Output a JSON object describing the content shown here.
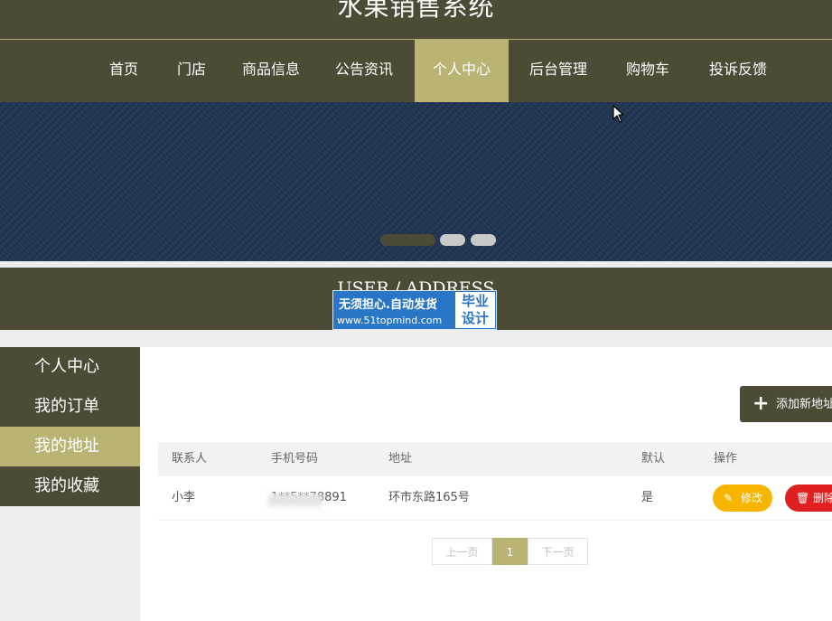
{
  "header": {
    "title": "水果销售系统"
  },
  "nav": {
    "items": [
      {
        "label": "首页",
        "active": false
      },
      {
        "label": "门店",
        "active": false
      },
      {
        "label": "商品信息",
        "active": false
      },
      {
        "label": "公告资讯",
        "active": false
      },
      {
        "label": "个人中心",
        "active": true
      },
      {
        "label": "后台管理",
        "active": false
      },
      {
        "label": "购物车",
        "active": false
      },
      {
        "label": "投诉反馈",
        "active": false
      }
    ]
  },
  "banner": {
    "slide_count": 3,
    "active_slide": 1
  },
  "section": {
    "title": "USER / ADDRESS"
  },
  "watermark": {
    "line1": "无须担心.自动发货",
    "url": "www.51topmind.com",
    "box_line1": "毕业",
    "box_line2": "设计"
  },
  "sidebar": {
    "items": [
      {
        "label": "个人中心",
        "active": false
      },
      {
        "label": "我的订单",
        "active": false
      },
      {
        "label": "我的地址",
        "active": true
      },
      {
        "label": "我的收藏",
        "active": false
      }
    ]
  },
  "toolbar": {
    "add_label": "添加新地址",
    "add_icon": "plus-icon"
  },
  "table": {
    "headers": [
      "联系人",
      "手机号码",
      "地址",
      "默认",
      "操作"
    ],
    "rows": [
      {
        "contact": "小李",
        "phone": "1**5**78891",
        "address": "环市东路165号",
        "is_default": "是",
        "edit_label": "修改",
        "delete_label": "删除"
      }
    ]
  },
  "pagination": {
    "prev_label": "上一页",
    "current_page": "1",
    "next_label": "下一页"
  },
  "colors": {
    "brand_dark": "#4d4b35",
    "accent": "#b9b474",
    "banner": "#1f3352",
    "edit": "#f7b500",
    "delete": "#e02020"
  }
}
